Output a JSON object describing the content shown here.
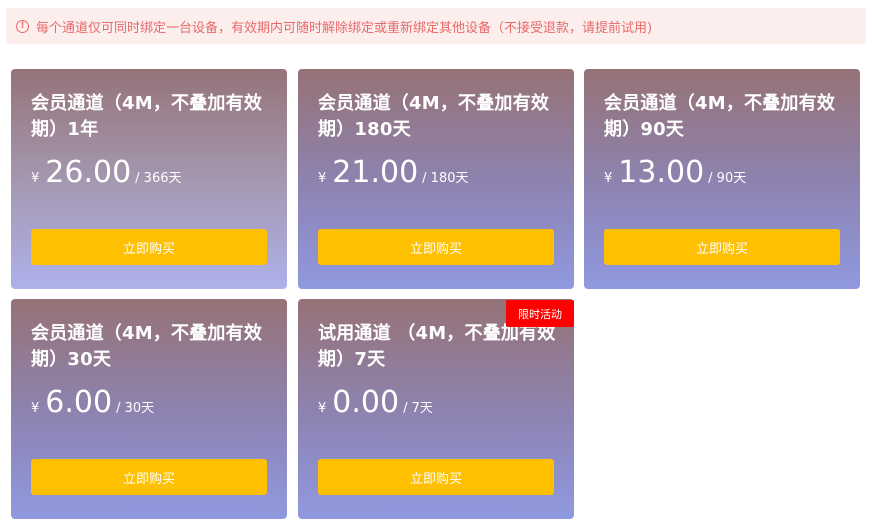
{
  "notice": {
    "icon": "info-icon",
    "text": "每个通道仅可同时绑定一台设备，有效期内可随时解除绑定或重新绑定其他设备（不接受退款，请提前试用)"
  },
  "plans": [
    {
      "title": "会员通道（4M，不叠加有效期）1年",
      "currency": "¥",
      "price": "26.00",
      "period": "/ 366天",
      "button": "立即购买"
    },
    {
      "title": "会员通道（4M，不叠加有效期）180天",
      "currency": "¥",
      "price": "21.00",
      "period": "/ 180天",
      "button": "立即购买"
    },
    {
      "title": "会员通道（4M，不叠加有效期）90天",
      "currency": "¥",
      "price": "13.00",
      "period": "/ 90天",
      "button": "立即购买"
    },
    {
      "title": "会员通道（4M，不叠加有效期）30天",
      "currency": "¥",
      "price": "6.00",
      "period": "/ 30天",
      "button": "立即购买"
    },
    {
      "title": "试用通道 （4M，不叠加有效期）7天",
      "currency": "¥",
      "price": "0.00",
      "period": "/ 7天",
      "button": "立即购买",
      "badge": "限时活动"
    }
  ],
  "colors": {
    "notice_bg": "#fdeeee",
    "notice_text": "#e86a6a",
    "button": "#fec000",
    "badge": "#ff0000"
  }
}
